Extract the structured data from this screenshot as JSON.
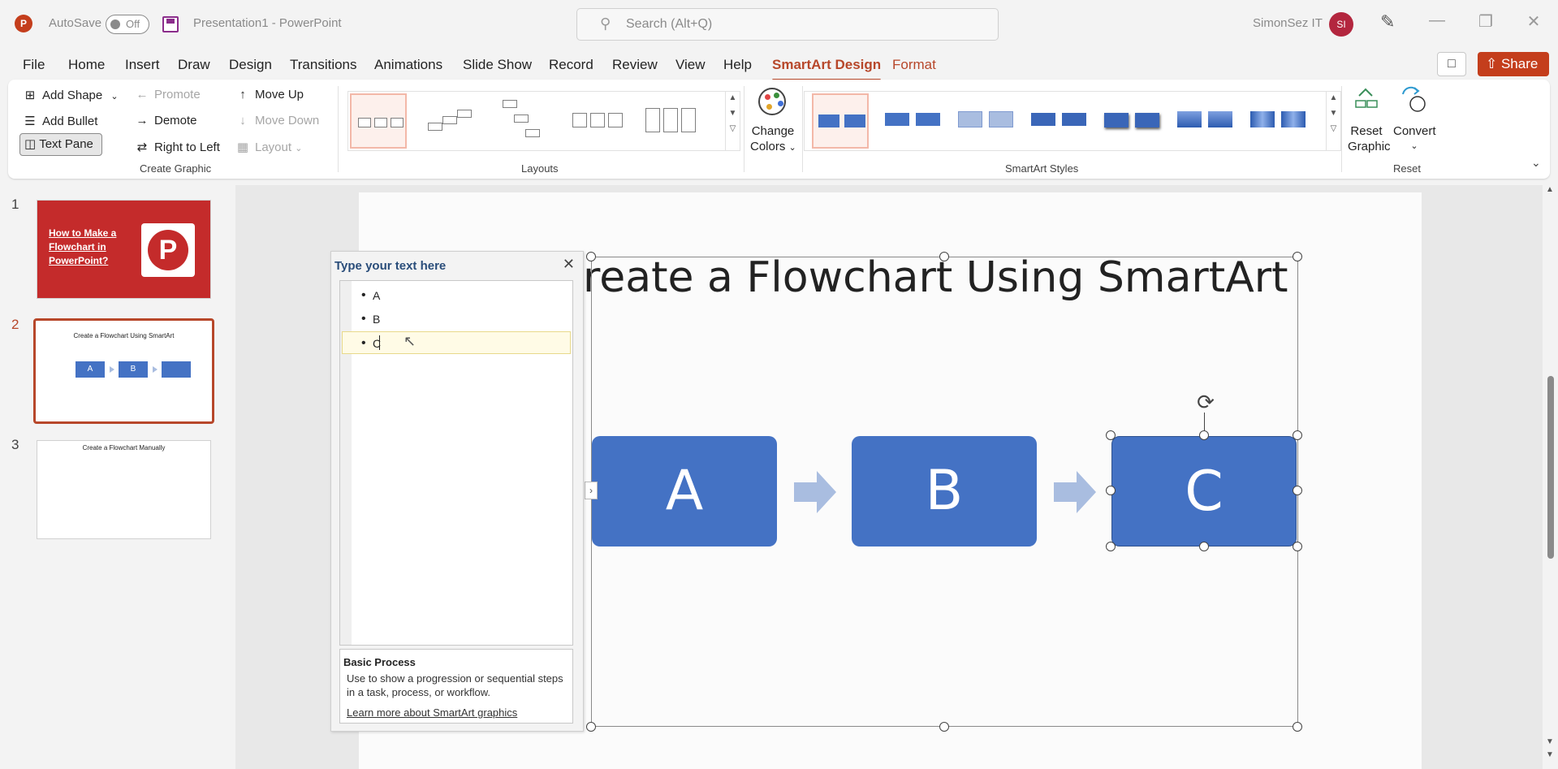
{
  "titlebar": {
    "app_icon": "P",
    "autosave_label": "AutoSave",
    "autosave_state": "Off",
    "doc_title": "Presentation1  -  PowerPoint",
    "search_placeholder": "Search (Alt+Q)",
    "user_name": "SimonSez IT",
    "user_initials": "SI"
  },
  "tabs": [
    "File",
    "Home",
    "Insert",
    "Draw",
    "Design",
    "Transitions",
    "Animations",
    "Slide Show",
    "Record",
    "Review",
    "View",
    "Help",
    "SmartArt Design",
    "Format"
  ],
  "active_tab": "SmartArt Design",
  "share_label": "Share",
  "ribbon": {
    "create_graphic": {
      "add_shape": "Add Shape",
      "add_bullet": "Add Bullet",
      "text_pane": "Text Pane",
      "promote": "Promote",
      "demote": "Demote",
      "right_to_left": "Right to Left",
      "move_up": "Move Up",
      "move_down": "Move Down",
      "layout": "Layout",
      "label": "Create Graphic"
    },
    "layouts_label": "Layouts",
    "change_colors": [
      "Change",
      "Colors"
    ],
    "smartart_styles_label": "SmartArt Styles",
    "reset": {
      "reset_graphic": [
        "Reset",
        "Graphic"
      ],
      "convert": "Convert",
      "label": "Reset"
    }
  },
  "slides": [
    {
      "number": "1",
      "title_lines": [
        "How to Make a",
        "Flowchart in",
        "PowerPoint?"
      ]
    },
    {
      "number": "2",
      "title": "Create a Flowchart Using SmartArt",
      "boxes": [
        "A",
        "B",
        ""
      ]
    },
    {
      "number": "3",
      "title": "Create a Flowchart Manually"
    }
  ],
  "text_pane": {
    "title": "Type your text here",
    "items": [
      "A",
      "B",
      "C"
    ],
    "info_heading": "Basic Process",
    "info_description": "Use to show a progression or sequential steps in a task, process, or workflow.",
    "info_link": "Learn more about SmartArt graphics"
  },
  "slide_content": {
    "title": "reate a Flowchart Using SmartArt",
    "boxes": [
      "A",
      "B",
      "C"
    ]
  },
  "colors": {
    "accent": "#b7472a",
    "share": "#c43e1c",
    "flow_box": "#4472c4",
    "arrow": "#a9bde0"
  }
}
